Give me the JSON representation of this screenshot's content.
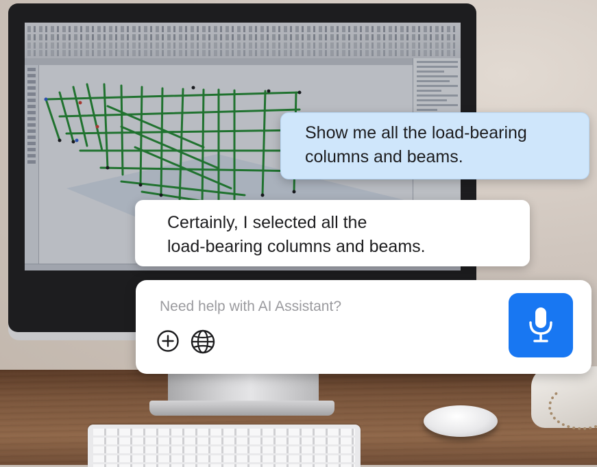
{
  "conversation": {
    "user_message": {
      "line1": "Show me all the load-bearing",
      "line2": "columns and beams."
    },
    "assistant_message": {
      "line1": "Certainly, I selected all the",
      "line2": "load-bearing columns and beams."
    }
  },
  "composer": {
    "placeholder": "Need help with AI Assistant?",
    "value": "",
    "add_icon": "plus-circle-icon",
    "language_icon": "globe-icon",
    "mic_icon": "microphone-icon"
  },
  "colors": {
    "user_bubble": "#cfe6fb",
    "assistant_bubble": "#ffffff",
    "mic_button": "#1877f2",
    "structure_members": "#1e8c2a"
  }
}
